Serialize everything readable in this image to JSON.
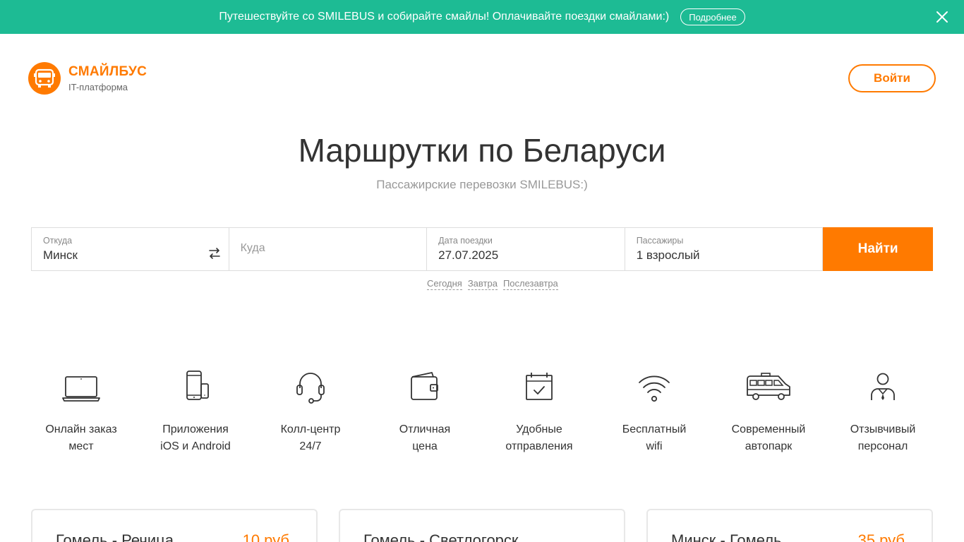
{
  "promo": {
    "text": "Путешествуйте со SMILEBUS и собирайте смайлы! Оплачивайте поездки смайлами:)",
    "more_label": "Подробнее",
    "close_icon": "close-icon"
  },
  "header": {
    "brand": "СМАЙЛБУС",
    "subtitle": "IT-платформа",
    "logo_icon": "bus-icon",
    "login_label": "Войти"
  },
  "hero": {
    "title": "Маршрутки по Беларуси",
    "subtitle": "Пассажирские перевозки SMILEBUS:)"
  },
  "search": {
    "from_label": "Откуда",
    "from_value": "Минск",
    "to_placeholder": "Куда",
    "date_label": "Дата поездки",
    "date_value": "27.07.2025",
    "passengers_label": "Пассажиры",
    "passengers_value": "1 взрослый",
    "find_label": "Найти",
    "quick_dates": [
      "Сегодня",
      "Завтра",
      "Послезавтра"
    ]
  },
  "features": [
    {
      "icon": "laptop-icon",
      "label": "Онлайн заказ\nмест"
    },
    {
      "icon": "devices-icon",
      "label": "Приложения\niOS и Android"
    },
    {
      "icon": "headset-icon",
      "label": "Колл-центр\n24/7"
    },
    {
      "icon": "wallet-icon",
      "label": "Отличная\nцена"
    },
    {
      "icon": "calendar-check-icon",
      "label": "Удобные\nотправления"
    },
    {
      "icon": "wifi-icon",
      "label": "Бесплатный\nwifi"
    },
    {
      "icon": "minibus-icon",
      "label": "Современный\nавтопарк"
    },
    {
      "icon": "staff-icon",
      "label": "Отзывчивый\nперсонал"
    }
  ],
  "routes": [
    {
      "route": "Гомель - Речица",
      "price": "10 руб"
    },
    {
      "route": "Гомель - Светлогорск",
      "price": ""
    },
    {
      "route": "Минск - Гомель",
      "price": "35 руб"
    }
  ],
  "colors": {
    "promo_bg": "#1dbb94",
    "accent": "#ff7a00"
  }
}
